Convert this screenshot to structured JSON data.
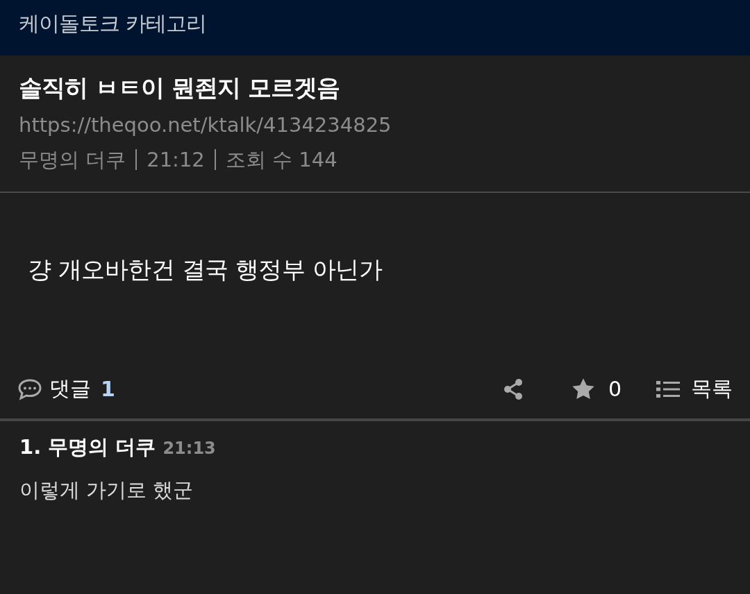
{
  "header": {
    "title": "케이돌토크 카테고리"
  },
  "post": {
    "title": "솔직히 ㅂㅌ이 뭔죈지 모르겟음",
    "url": "https://theqoo.net/ktalk/4134234825",
    "author": "무명의 더쿠",
    "time": "21:12",
    "views": "조회 수 144",
    "body": "걍 개오바한건 결국 행정부 아닌가"
  },
  "actions": {
    "comments_label": "댓글",
    "comments_count": "1",
    "likes": "0",
    "list_label": "목록"
  },
  "comments": [
    {
      "number": "1.",
      "author": "무명의 더쿠",
      "time": "21:13",
      "text": "이렇게 가기로 했군"
    }
  ]
}
